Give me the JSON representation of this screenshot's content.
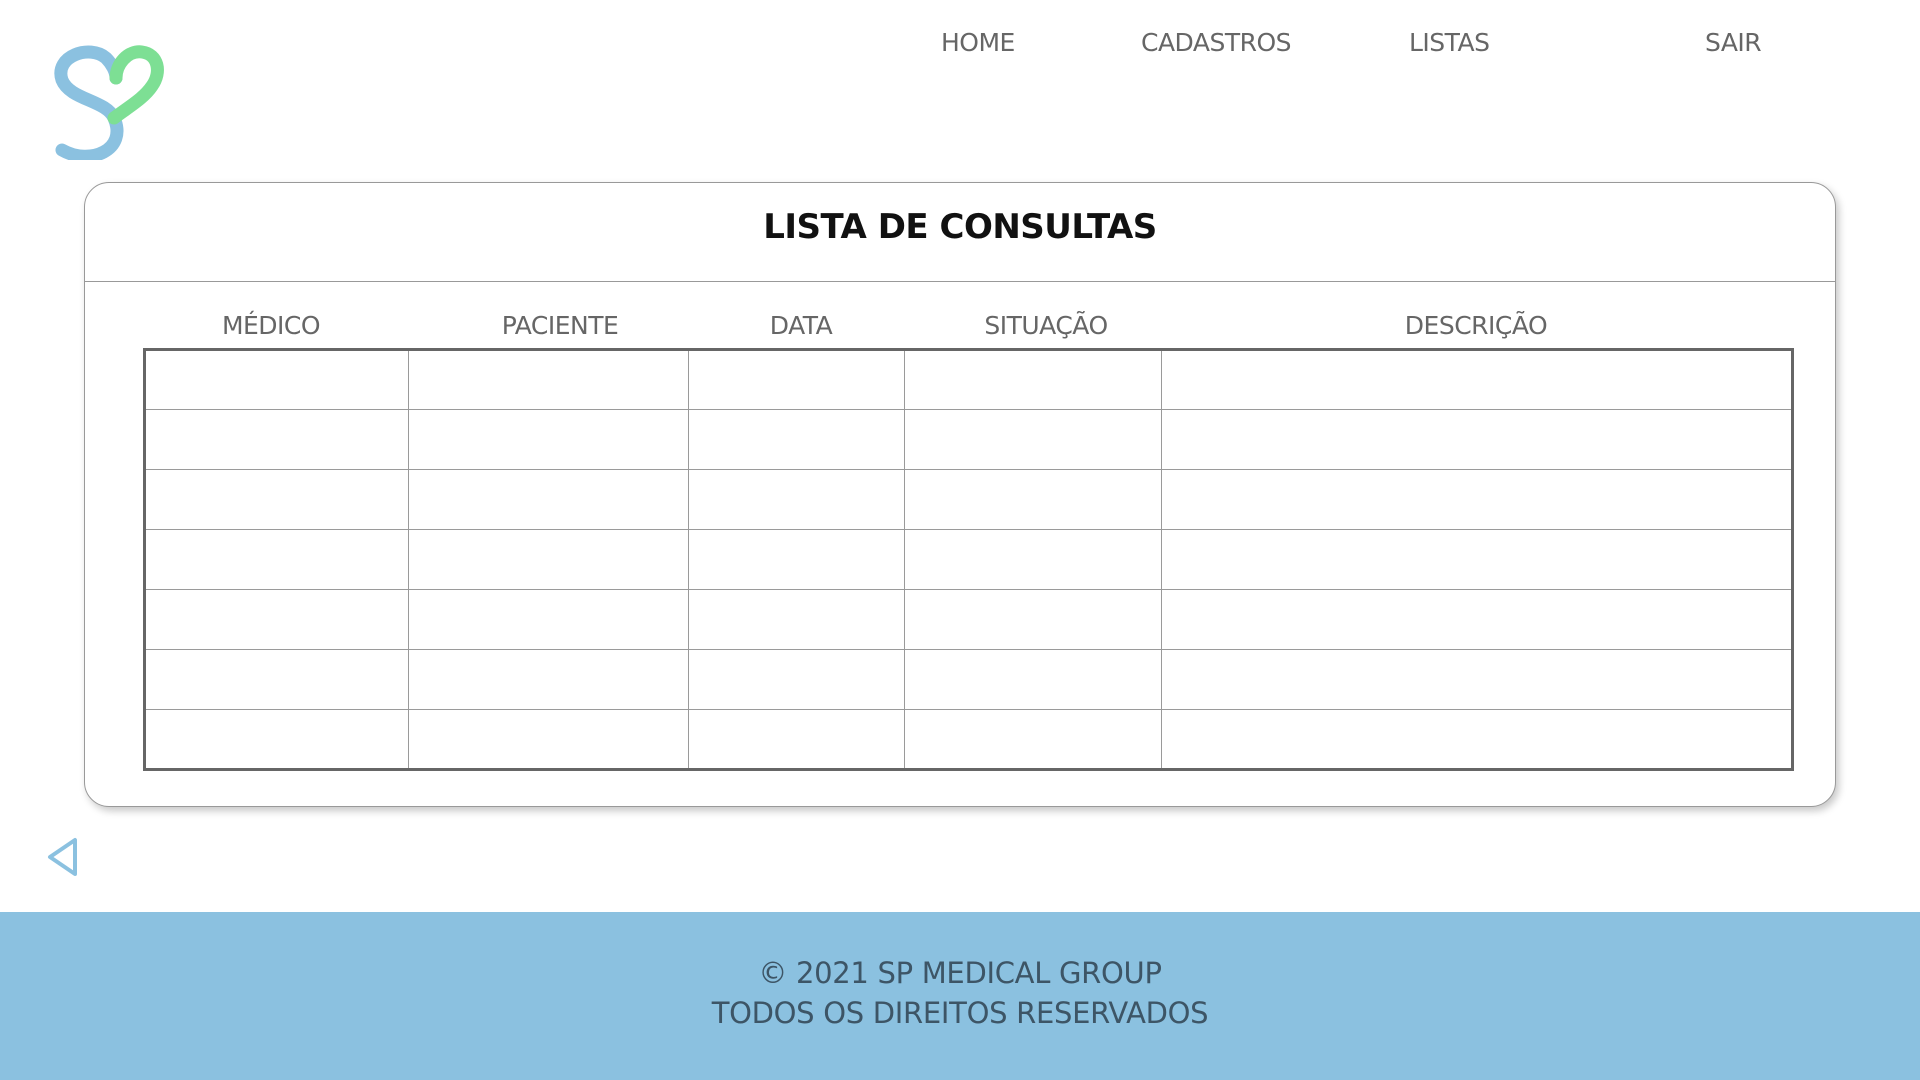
{
  "nav": {
    "home": "HOME",
    "cadastros": "CADASTROS",
    "listas": "LISTAS",
    "sair": "SAIR"
  },
  "logo": {
    "icon": "heart-s-logo",
    "colors": {
      "blue": "#8bc1e0",
      "green": "#7ddf94"
    }
  },
  "card": {
    "title": "LISTA DE CONSULTAS",
    "columns": [
      "MÉDICO",
      "PACIENTE",
      "DATA",
      "SITUAÇÃO",
      "DESCRIÇÃO"
    ],
    "rows": [
      [
        "",
        "",
        "",
        "",
        ""
      ],
      [
        "",
        "",
        "",
        "",
        ""
      ],
      [
        "",
        "",
        "",
        "",
        ""
      ],
      [
        "",
        "",
        "",
        "",
        ""
      ],
      [
        "",
        "",
        "",
        "",
        ""
      ],
      [
        "",
        "",
        "",
        "",
        ""
      ],
      [
        "",
        "",
        "",
        "",
        ""
      ]
    ]
  },
  "back": {
    "icon": "back-arrow-icon",
    "color": "#8bc1e0"
  },
  "footer": {
    "copyright": "© 2021 SP MEDICAL GROUP",
    "rights": "TODOS OS DIREITOS RESERVADOS",
    "background": "#8bc1e0"
  }
}
